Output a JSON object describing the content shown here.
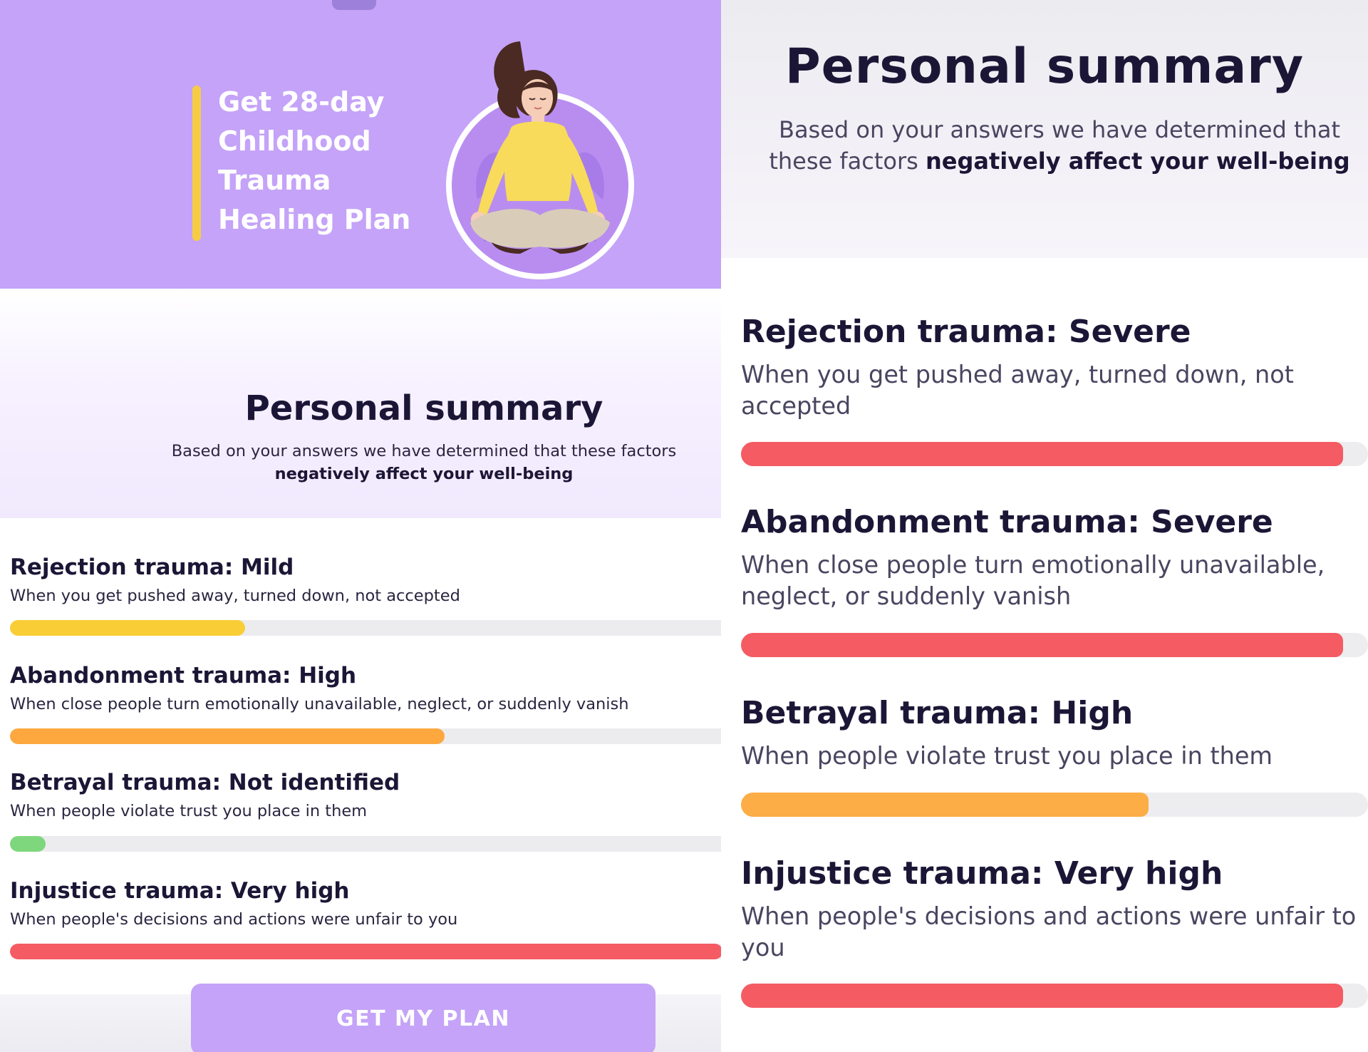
{
  "left": {
    "hero": {
      "title_lines": [
        "Get 28-day",
        "Childhood",
        "Trauma",
        "Healing Plan"
      ],
      "accent_color": "#f7cc45",
      "background_color": "#c4a3f8",
      "illustration_icon": "meditating-woman-illustration"
    },
    "summary": {
      "title": "Personal summary",
      "subtitle": "Based on your answers we have determined that these factors",
      "subtitle_bold": "negatively affect your well-being"
    },
    "items": [
      {
        "title": "Rejection trauma: Mild",
        "description": "When you get pushed away, turned down, not accepted",
        "level": 0.33,
        "color": "#f9cd35"
      },
      {
        "title": "Abandonment trauma: High",
        "description": "When close people turn emotionally unavailable, neglect, or suddenly vanish",
        "level": 0.61,
        "color": "#fca83f"
      },
      {
        "title": "Betrayal trauma: Not identified",
        "description": "When people violate trust you place in them",
        "level": 0.05,
        "color": "#7ed77d"
      },
      {
        "title": "Injustice trauma: Very high",
        "description": "When people's decisions and actions were unfair to you",
        "level": 1.0,
        "color": "#f45b63"
      }
    ],
    "cta_label": "GET MY PLAN"
  },
  "right": {
    "summary": {
      "title": "Personal summary",
      "subtitle": "Based on your answers we have determined that these factors",
      "subtitle_bold": "negatively affect your well-being"
    },
    "items": [
      {
        "title": "Rejection trauma: Severe",
        "description": "When you get pushed away, turned down, not accepted",
        "level": 0.96,
        "color": "#f45b63"
      },
      {
        "title": "Abandonment trauma: Severe",
        "description": "When close people turn emotionally unavailable, neglect, or suddenly vanish",
        "level": 0.96,
        "color": "#f45b63"
      },
      {
        "title": "Betrayal trauma: High",
        "description": "When people violate trust you place in them",
        "level": 0.65,
        "color": "#fcad46"
      },
      {
        "title": "Injustice trauma: Very high",
        "description": "When people's decisions and actions were unfair to you",
        "level": 0.96,
        "color": "#f45b63"
      }
    ]
  }
}
